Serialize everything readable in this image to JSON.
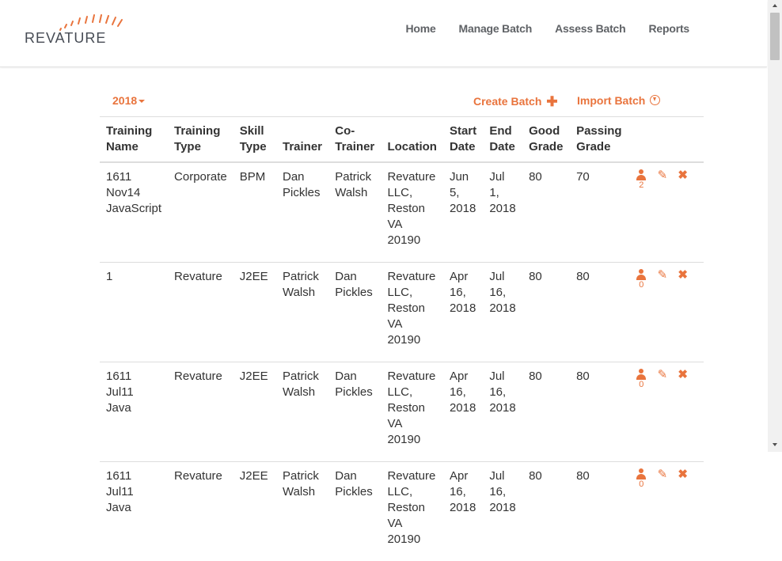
{
  "brand": {
    "logo_text": "REVATURE",
    "accent": "#e9743d"
  },
  "nav": {
    "items": [
      "Home",
      "Manage Batch",
      "Assess Batch",
      "Reports"
    ]
  },
  "toolbar": {
    "year": "2018",
    "create_label": "Create Batch",
    "import_label": "Import Batch"
  },
  "table": {
    "headers": [
      "Training Name",
      "Training Type",
      "Skill Type",
      "Trainer",
      "Co-Trainer",
      "Location",
      "Start Date",
      "End Date",
      "Good Grade",
      "Passing Grade"
    ],
    "rows": [
      {
        "name": "1611 Nov14 JavaScript",
        "type": "Corporate",
        "skill": "BPM",
        "trainer": "Dan Pickles",
        "cotrainer": "Patrick Walsh",
        "location": "Revature LLC, Reston VA 20190",
        "start": "Jun 5, 2018",
        "end": "Jul 1, 2018",
        "good": "80",
        "passing": "70",
        "trainees": "2"
      },
      {
        "name": "1",
        "type": "Revature",
        "skill": "J2EE",
        "trainer": "Patrick Walsh",
        "cotrainer": "Dan Pickles",
        "location": "Revature LLC, Reston VA 20190",
        "start": "Apr 16, 2018",
        "end": "Jul 16, 2018",
        "good": "80",
        "passing": "80",
        "trainees": "0"
      },
      {
        "name": "1611 Jul11 Java",
        "type": "Revature",
        "skill": "J2EE",
        "trainer": "Patrick Walsh",
        "cotrainer": "Dan Pickles",
        "location": "Revature LLC, Reston VA 20190",
        "start": "Apr 16, 2018",
        "end": "Jul 16, 2018",
        "good": "80",
        "passing": "80",
        "trainees": "0"
      },
      {
        "name": "1611 Jul11 Java",
        "type": "Revature",
        "skill": "J2EE",
        "trainer": "Patrick Walsh",
        "cotrainer": "Dan Pickles",
        "location": "Revature LLC, Reston VA 20190",
        "start": "Apr 16, 2018",
        "end": "Jul 16, 2018",
        "good": "80",
        "passing": "80",
        "trainees": "0"
      }
    ]
  }
}
